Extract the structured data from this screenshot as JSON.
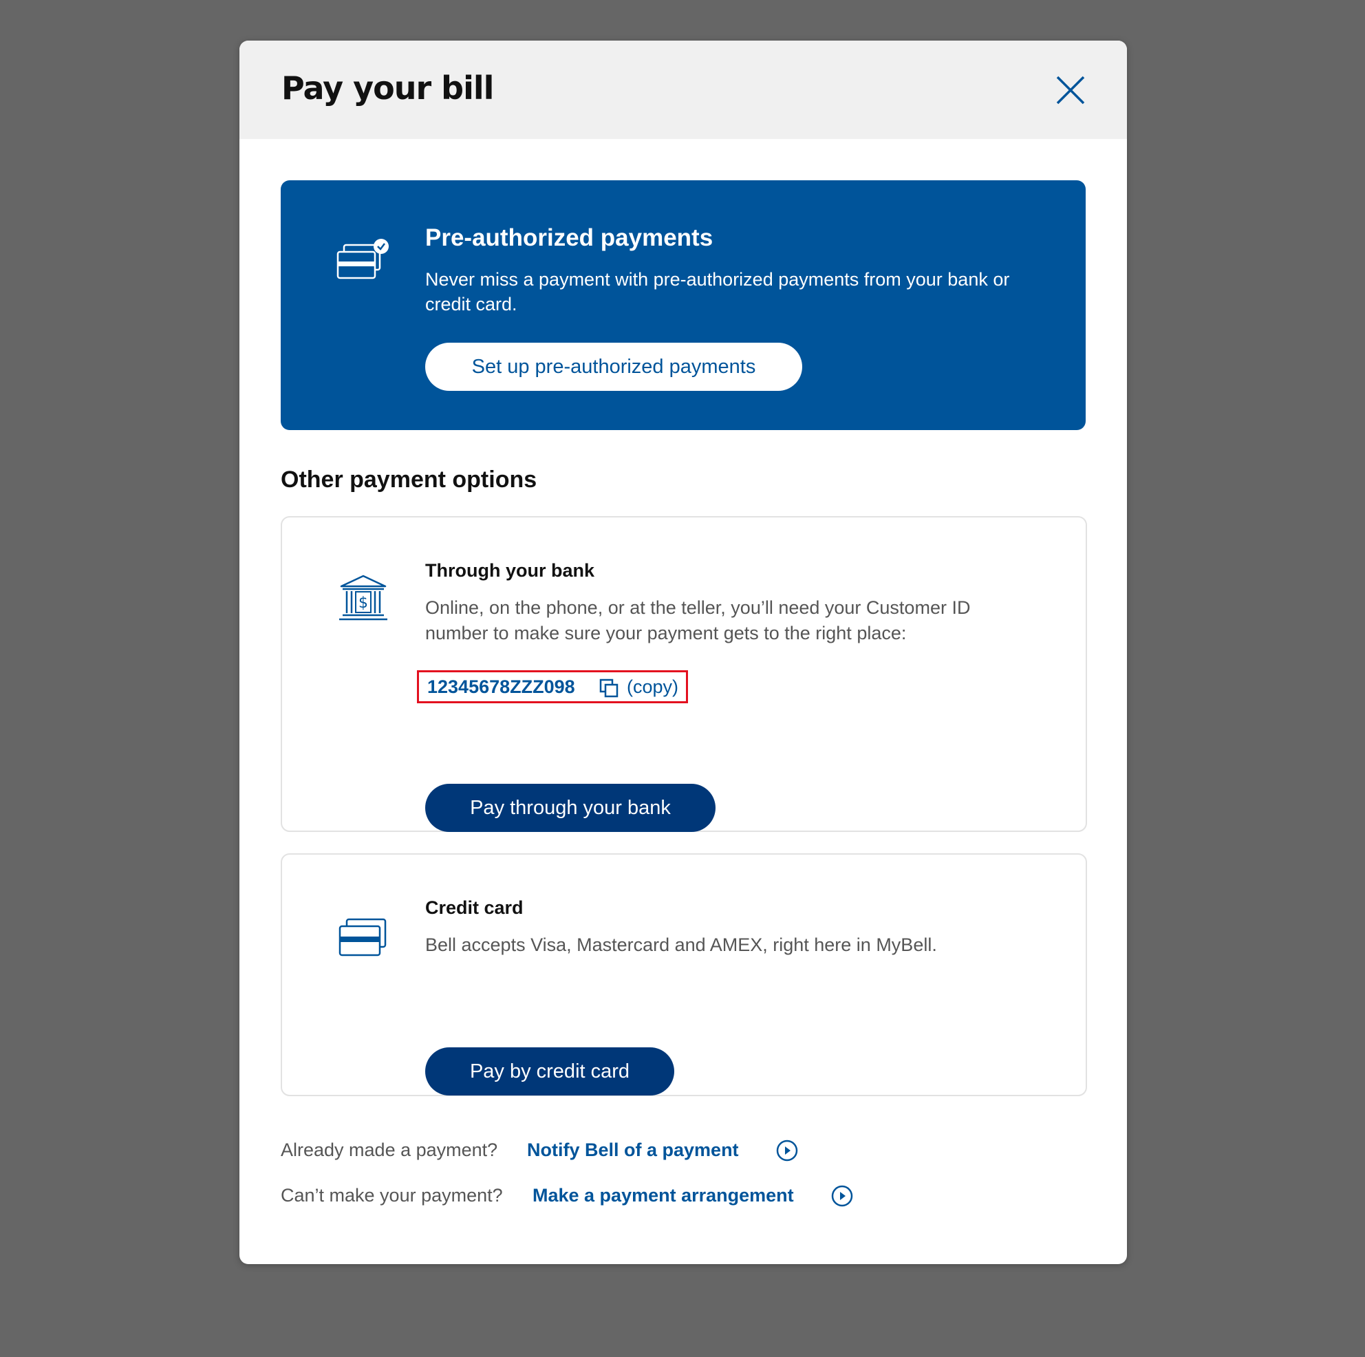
{
  "modal": {
    "title": "Pay your bill"
  },
  "preauth": {
    "title": "Pre-authorized payments",
    "description": "Never miss a payment with pre-authorized payments from your bank or credit card.",
    "button_label": "Set up pre-authorized payments"
  },
  "other_options": {
    "heading": "Other payment options"
  },
  "bank": {
    "title": "Through your bank",
    "description": "Online, on the phone, or at the teller, you’ll need your Customer ID number to make sure your payment gets to the right place:",
    "customer_id": "12345678ZZZ098",
    "copy_label": "(copy)",
    "button_label": "Pay through your bank"
  },
  "credit_card": {
    "title": "Credit card",
    "description": "Bell accepts Visa, Mastercard and AMEX, right here in MyBell.",
    "button_label": "Pay by credit card"
  },
  "footer": {
    "notify_question": "Already made a payment?",
    "notify_link": "Notify Bell of a payment",
    "arrangement_question": "Can’t make your payment?",
    "arrangement_link": "Make a payment arrangement"
  },
  "icons": {
    "close": "close-icon",
    "preauth": "credit-card-check-icon",
    "bank": "bank-building-icon",
    "credit_card": "credit-card-icon",
    "copy": "copy-icon",
    "arrow": "circle-play-icon"
  },
  "colors": {
    "brand_blue": "#00549a",
    "dark_blue": "#003778",
    "highlight_red": "#e3101f"
  }
}
